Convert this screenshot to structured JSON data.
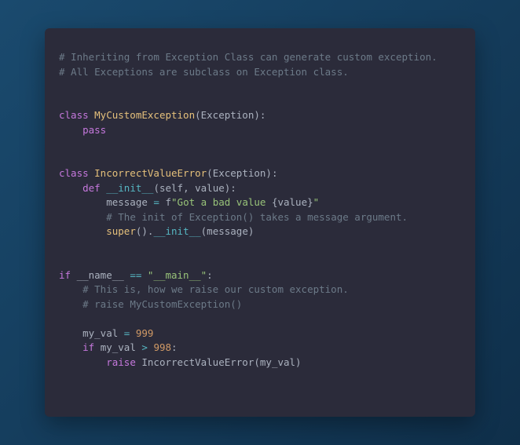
{
  "code": {
    "tokens": [
      [
        {
          "t": "# Inheriting from Exception Class can generate custom exception.",
          "c": "c-comment"
        }
      ],
      [
        {
          "t": "# All Exceptions are subclass on Exception class.",
          "c": "c-comment"
        }
      ],
      [],
      [],
      [
        {
          "t": "class ",
          "c": "c-keyword"
        },
        {
          "t": "MyCustomException",
          "c": "c-classname"
        },
        {
          "t": "(",
          "c": "c-punct"
        },
        {
          "t": "Exception",
          "c": "c-ident"
        },
        {
          "t": "):",
          "c": "c-punct"
        }
      ],
      [
        {
          "t": "    ",
          "c": ""
        },
        {
          "t": "pass",
          "c": "c-keyword"
        }
      ],
      [],
      [],
      [
        {
          "t": "class ",
          "c": "c-keyword"
        },
        {
          "t": "IncorrectValueError",
          "c": "c-classname"
        },
        {
          "t": "(",
          "c": "c-punct"
        },
        {
          "t": "Exception",
          "c": "c-ident"
        },
        {
          "t": "):",
          "c": "c-punct"
        }
      ],
      [
        {
          "t": "    ",
          "c": ""
        },
        {
          "t": "def ",
          "c": "c-keyword"
        },
        {
          "t": "__init__",
          "c": "c-funcname"
        },
        {
          "t": "(",
          "c": "c-punct"
        },
        {
          "t": "self, value",
          "c": "c-param"
        },
        {
          "t": "):",
          "c": "c-punct"
        }
      ],
      [
        {
          "t": "        message ",
          "c": "c-ident"
        },
        {
          "t": "=",
          "c": "c-op"
        },
        {
          "t": " f",
          "c": "c-ident"
        },
        {
          "t": "\"Got a bad value ",
          "c": "c-string"
        },
        {
          "t": "{value}",
          "c": "c-interp"
        },
        {
          "t": "\"",
          "c": "c-string"
        }
      ],
      [
        {
          "t": "        ",
          "c": ""
        },
        {
          "t": "# The init of Exception() takes a message argument.",
          "c": "c-comment"
        }
      ],
      [
        {
          "t": "        ",
          "c": ""
        },
        {
          "t": "super",
          "c": "c-builtin"
        },
        {
          "t": "().",
          "c": "c-punct"
        },
        {
          "t": "__init__",
          "c": "c-funcname"
        },
        {
          "t": "(message)",
          "c": "c-punct"
        }
      ],
      [],
      [],
      [
        {
          "t": "if ",
          "c": "c-keyword"
        },
        {
          "t": "__name__ ",
          "c": "c-ident"
        },
        {
          "t": "==",
          "c": "c-op"
        },
        {
          "t": " ",
          "c": ""
        },
        {
          "t": "\"__main__\"",
          "c": "c-string"
        },
        {
          "t": ":",
          "c": "c-punct"
        }
      ],
      [
        {
          "t": "    ",
          "c": ""
        },
        {
          "t": "# This is, how we raise our custom exception.",
          "c": "c-comment"
        }
      ],
      [
        {
          "t": "    ",
          "c": ""
        },
        {
          "t": "# raise MyCustomException()",
          "c": "c-comment"
        }
      ],
      [],
      [
        {
          "t": "    my_val ",
          "c": "c-ident"
        },
        {
          "t": "=",
          "c": "c-op"
        },
        {
          "t": " ",
          "c": ""
        },
        {
          "t": "999",
          "c": "c-number"
        }
      ],
      [
        {
          "t": "    ",
          "c": ""
        },
        {
          "t": "if ",
          "c": "c-keyword"
        },
        {
          "t": "my_val ",
          "c": "c-ident"
        },
        {
          "t": ">",
          "c": "c-op"
        },
        {
          "t": " ",
          "c": ""
        },
        {
          "t": "998",
          "c": "c-number"
        },
        {
          "t": ":",
          "c": "c-punct"
        }
      ],
      [
        {
          "t": "        ",
          "c": ""
        },
        {
          "t": "raise ",
          "c": "c-raise"
        },
        {
          "t": "IncorrectValueError",
          "c": "c-ident"
        },
        {
          "t": "(my_val)",
          "c": "c-punct"
        }
      ]
    ]
  }
}
